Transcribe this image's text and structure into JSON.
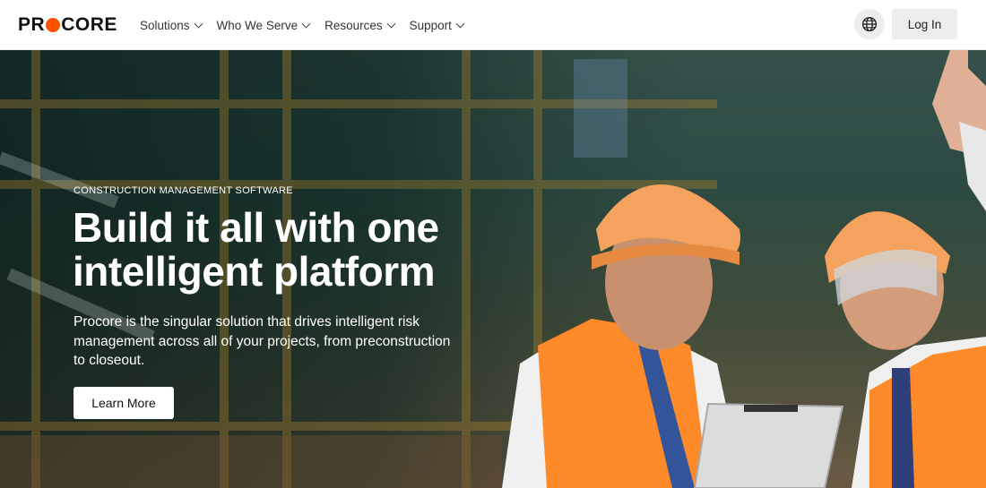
{
  "nav": {
    "logo_text_start": "PR",
    "logo_text_end": "CORE",
    "menu": [
      {
        "label": "Solutions"
      },
      {
        "label": "Who We Serve"
      },
      {
        "label": "Resources"
      },
      {
        "label": "Support"
      }
    ],
    "login_label": "Log In",
    "icons": {
      "language": "globe-icon",
      "menu_chevron": "chevron-down-icon"
    },
    "brand_color": "#ff5200"
  },
  "hero": {
    "eyebrow": "CONSTRUCTION MANAGEMENT SOFTWARE",
    "headline_line1": "Build it all with one",
    "headline_line2": "intelligent platform",
    "description": "Procore is the singular solution that drives intelligent risk management across all of your projects, from preconstruction to closeout.",
    "cta_label": "Learn More"
  }
}
